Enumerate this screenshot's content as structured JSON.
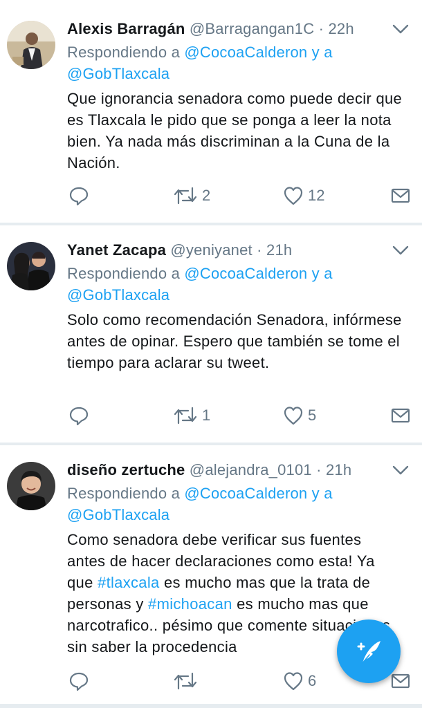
{
  "tweets": [
    {
      "name": "Alexis Barragán",
      "handle": "@Barragangan1C",
      "time": "· 22h",
      "reply_prefix": "Respondiendo a",
      "reply_to_1": "@CocoaCalderon y a",
      "reply_to_2": "@GobTlaxcala",
      "text": "Que ignorancia senadora como puede decir que es Tlaxcala le pido que se ponga a leer la nota bien.  Ya nada más discriminan a la Cuna de la Nación.",
      "retweets": "2",
      "likes": "12"
    },
    {
      "name": "Yanet Zacapa",
      "handle": "@yeniyanet",
      "time": "· 21h",
      "reply_prefix": "Respondiendo a",
      "reply_to_1": "@CocoaCalderon y a",
      "reply_to_2": "@GobTlaxcala",
      "text": "Solo como recomendación Senadora, infórmese antes de opinar. Espero que también se tome el tiempo para aclarar su tweet.",
      "retweets": "1",
      "likes": "5"
    },
    {
      "name": "diseño zertuche",
      "handle": "@alejandra_0101",
      "time": "· 21h",
      "reply_prefix": "Respondiendo a",
      "reply_to_1": "@CocoaCalderon y a",
      "reply_to_2": "@GobTlaxcala",
      "text_1": "Como senadora debe verificar sus fuentes antes de hacer declaraciones como esta! Ya que ",
      "hashtag_1": "#tlaxcala",
      "text_2": " es mucho mas que la trata de personas y ",
      "hashtag_2": "#michoacan",
      "text_3": " es mucho mas que narcotrafico.. pésimo que comente situaciones sin saber la procedencia",
      "retweets": "",
      "likes": "6"
    }
  ],
  "icons": {
    "reply": "reply-icon",
    "retweet": "retweet-icon",
    "like": "heart-icon",
    "dm": "envelope-icon",
    "more": "chevron-down-icon",
    "compose": "compose-tweet-icon"
  },
  "colors": {
    "link": "#1da1f2",
    "text": "#14171a",
    "muted": "#657786",
    "divider": "#e6ecf0",
    "fab": "#1da1f2"
  }
}
